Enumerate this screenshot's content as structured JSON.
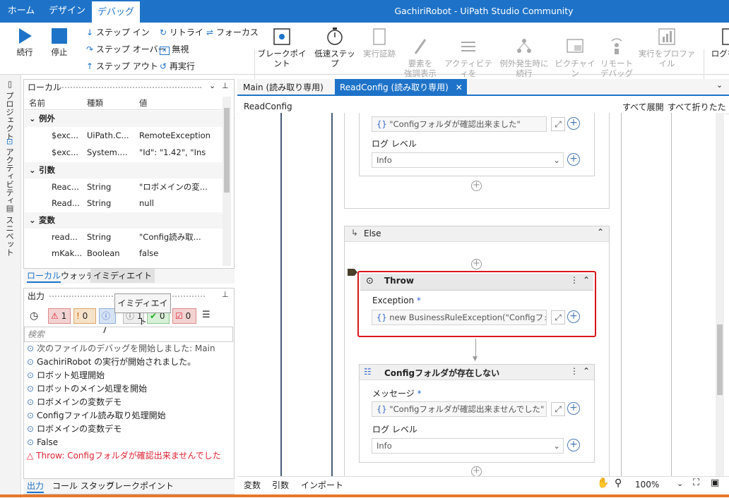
{
  "tabs": {
    "home": "ホーム",
    "design": "デザイン",
    "debug": "デバッグ"
  },
  "title": "GachiriRobot - UiPath Studio Community",
  "ribbon": {
    "continue": "続行",
    "stop": "停止",
    "step_in": "ステップ イン",
    "step_over": "ステップ オーバー",
    "step_out": "ステップ アウト",
    "retry": "リトライ",
    "ignore": "無視",
    "restart": "再実行",
    "focus": "フォーカス",
    "breakpoint": "ブレークポイント",
    "slow_step": "低速ステップ",
    "exec_trail": "実行証跡",
    "highlight": "要素を\n強調表示",
    "log_activity": "アクティビティを\nログ",
    "continue_on_exception": "例外発生時に\n続行",
    "pip": "ピクチャイン\nピクチャ",
    "remote_debug": "リモート\nデバッグ",
    "profile": "実行をプロファイル",
    "log": "ログを"
  },
  "leftstrip": {
    "project": "プロジェクト",
    "activity": "アクティビティ",
    "snippet": "スニペット"
  },
  "locals": {
    "title": "ローカル",
    "cols": [
      "名前",
      "種類",
      "値"
    ],
    "sections": {
      "exception": "例外",
      "args": "引数",
      "vars": "変数"
    },
    "rows": [
      {
        "name": "$exc...",
        "type": "UiPath.C...",
        "value": "RemoteException"
      },
      {
        "name": "$exc...",
        "type": "System....",
        "value": "\"Id\": \"1.42\",  \"Ins"
      },
      {
        "name": "Reac...",
        "type": "String",
        "value": "\"ロボメインの変..."
      },
      {
        "name": "Read...",
        "type": "String",
        "value": "null"
      },
      {
        "name": "read...",
        "type": "String",
        "value": "\"Config読み取..."
      },
      {
        "name": "mKak...",
        "type": "Boolean",
        "value": "false"
      }
    ],
    "tabs": [
      "ローカル",
      "ウォッチ",
      "イミディエイト"
    ]
  },
  "tooltip": "イミディエイト",
  "output": {
    "title": "出力",
    "badges": [
      {
        "icon": "error-icon",
        "count": "1"
      },
      {
        "icon": "warning-icon",
        "count": "0"
      },
      {
        "icon": "info-icon",
        "count": "7"
      },
      {
        "icon": "trace-icon",
        "count": "1"
      },
      {
        "icon": "verbose-icon",
        "count": "0"
      },
      {
        "icon": "debug-icon",
        "count": "0"
      }
    ],
    "search_placeholder": "検索",
    "lines": [
      "次のファイルのデバッグを開始しました: Main",
      "GachiriRobot の実行が開始されました。",
      "ロボット処理開始",
      "ロボットのメイン処理を開始",
      "ロボメインの変数デモ",
      "Configファイル読み取り処理開始",
      "ロボメインの変数デモ",
      "False",
      "Throw: Configフォルダが確認出来ませんでした"
    ],
    "tabs": [
      "出力",
      "コール スタック",
      "ブレークポイント"
    ]
  },
  "doc_tabs": [
    "Main (読み取り専用)",
    "ReadConfig (読み取り専用)"
  ],
  "breadcrumb": "ReadConfig",
  "expand_all": "すべて展開",
  "collapse_all": "すべて折りたたむ",
  "designer": {
    "top_msg": "\"Configフォルダが確認出来ました\"",
    "log_level_label": "ログ レベル",
    "log_level": "Info",
    "else_label": "Else",
    "throw_title": "Throw",
    "exception_label": "Exception",
    "exception_value": "new BusinessRuleException(\"Configフォル",
    "log_title": "Configフォルダが存在しない",
    "message_label": "メッセージ",
    "message_value": "\"Configフォルダが確認出来ませんでした\"",
    "log_level2": "Info"
  },
  "bottom": {
    "variables": "変数",
    "arguments": "引数",
    "imports": "インポート",
    "zoom": "100%"
  }
}
